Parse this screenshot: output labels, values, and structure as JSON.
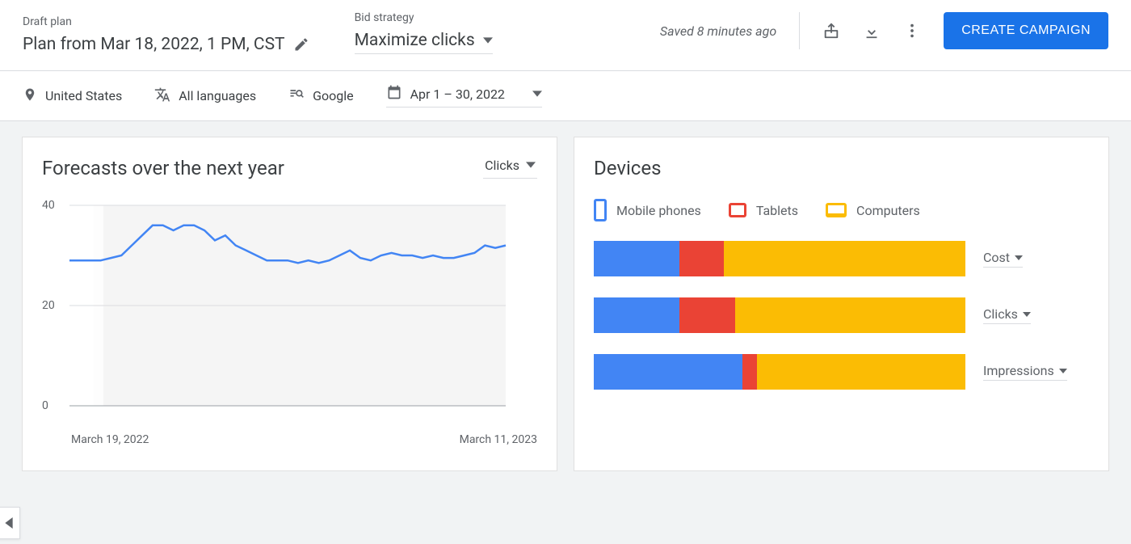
{
  "header": {
    "draft_label": "Draft plan",
    "plan_name": "Plan from Mar 18, 2022, 1 PM, CST",
    "bid_label": "Bid strategy",
    "bid_value": "Maximize clicks",
    "saved_text": "Saved 8 minutes ago",
    "create_label": "CREATE CAMPAIGN"
  },
  "filters": {
    "location": "United States",
    "languages": "All languages",
    "network": "Google",
    "date_range": "Apr 1 – 30, 2022"
  },
  "forecasts": {
    "title": "Forecasts over the next year",
    "metric": "Clicks"
  },
  "devices": {
    "title": "Devices",
    "legend": {
      "mobile": "Mobile phones",
      "tablets": "Tablets",
      "computers": "Computers"
    },
    "rows": {
      "cost": "Cost",
      "clicks": "Clicks",
      "impressions": "Impressions"
    }
  },
  "colors": {
    "blue": "#4285f4",
    "red": "#ea4335",
    "yellow": "#fbbc04"
  },
  "chart_data": [
    {
      "type": "line",
      "title": "Forecasts over the next year",
      "ylabel": "Clicks",
      "ylim": [
        0,
        40
      ],
      "x": [
        "March 19, 2022",
        "March 11, 2023"
      ],
      "values": [
        29,
        29,
        29,
        29,
        29.5,
        30,
        32,
        34,
        36,
        36,
        35,
        36,
        36,
        35,
        33,
        34,
        32,
        31,
        30,
        29,
        29,
        29,
        28.5,
        29,
        28.5,
        29,
        30,
        31,
        29.5,
        29,
        30,
        30.5,
        30,
        30,
        29.5,
        30,
        29.5,
        29.5,
        30,
        30.5,
        32,
        31.5,
        32
      ]
    },
    {
      "type": "bar",
      "title": "Devices",
      "categories": [
        "Cost",
        "Clicks",
        "Impressions"
      ],
      "series": [
        {
          "name": "Mobile phones",
          "values": [
            23,
            23,
            40
          ]
        },
        {
          "name": "Tablets",
          "values": [
            12,
            15,
            4
          ]
        },
        {
          "name": "Computers",
          "values": [
            65,
            62,
            56
          ]
        }
      ]
    }
  ]
}
